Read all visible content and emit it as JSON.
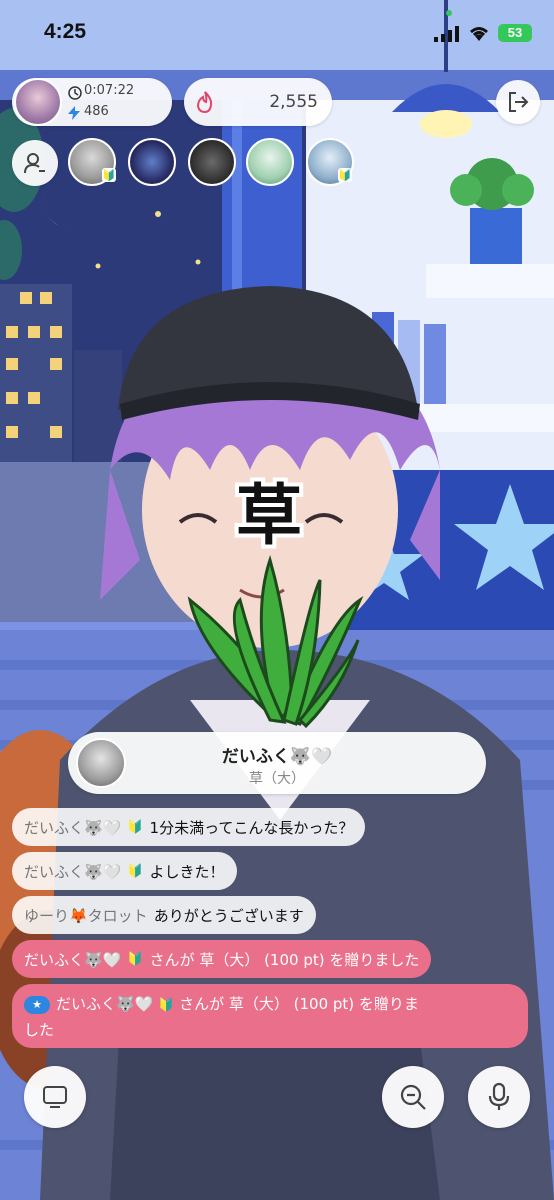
{
  "status_bar": {
    "time": "4:25",
    "battery": "53"
  },
  "stream": {
    "elapsed": "0:07:22",
    "listeners": "486",
    "points": "2,555"
  },
  "overlay_kanji": "草",
  "gift_banner": {
    "sender": "だいふく🐺🤍",
    "item": "草（大）"
  },
  "chat": [
    {
      "name": "だいふく🐺🤍",
      "badge": "🔰",
      "message": "1分未満ってこんな長かった？"
    },
    {
      "name": "だいふく🐺🤍",
      "badge": "🔰",
      "message": "よしきた！"
    },
    {
      "name": "ゆーり🦊タロット",
      "badge": "",
      "message": "ありがとうございます"
    },
    {
      "name": "だいふく🐺🤍",
      "badge": "🔰",
      "message": "さんが 草（大） (100 pt) を贈りました"
    },
    {
      "name": "だいふく🐺🤍",
      "badge": "🔰",
      "message_line1": "さんが 草（大） (100 pt) を贈りま",
      "message_line2": "した"
    }
  ],
  "colors": {
    "gift_pink": "#ea6f8a",
    "night_sky": "#2e3a78",
    "room_blue": "#6f86d6"
  }
}
